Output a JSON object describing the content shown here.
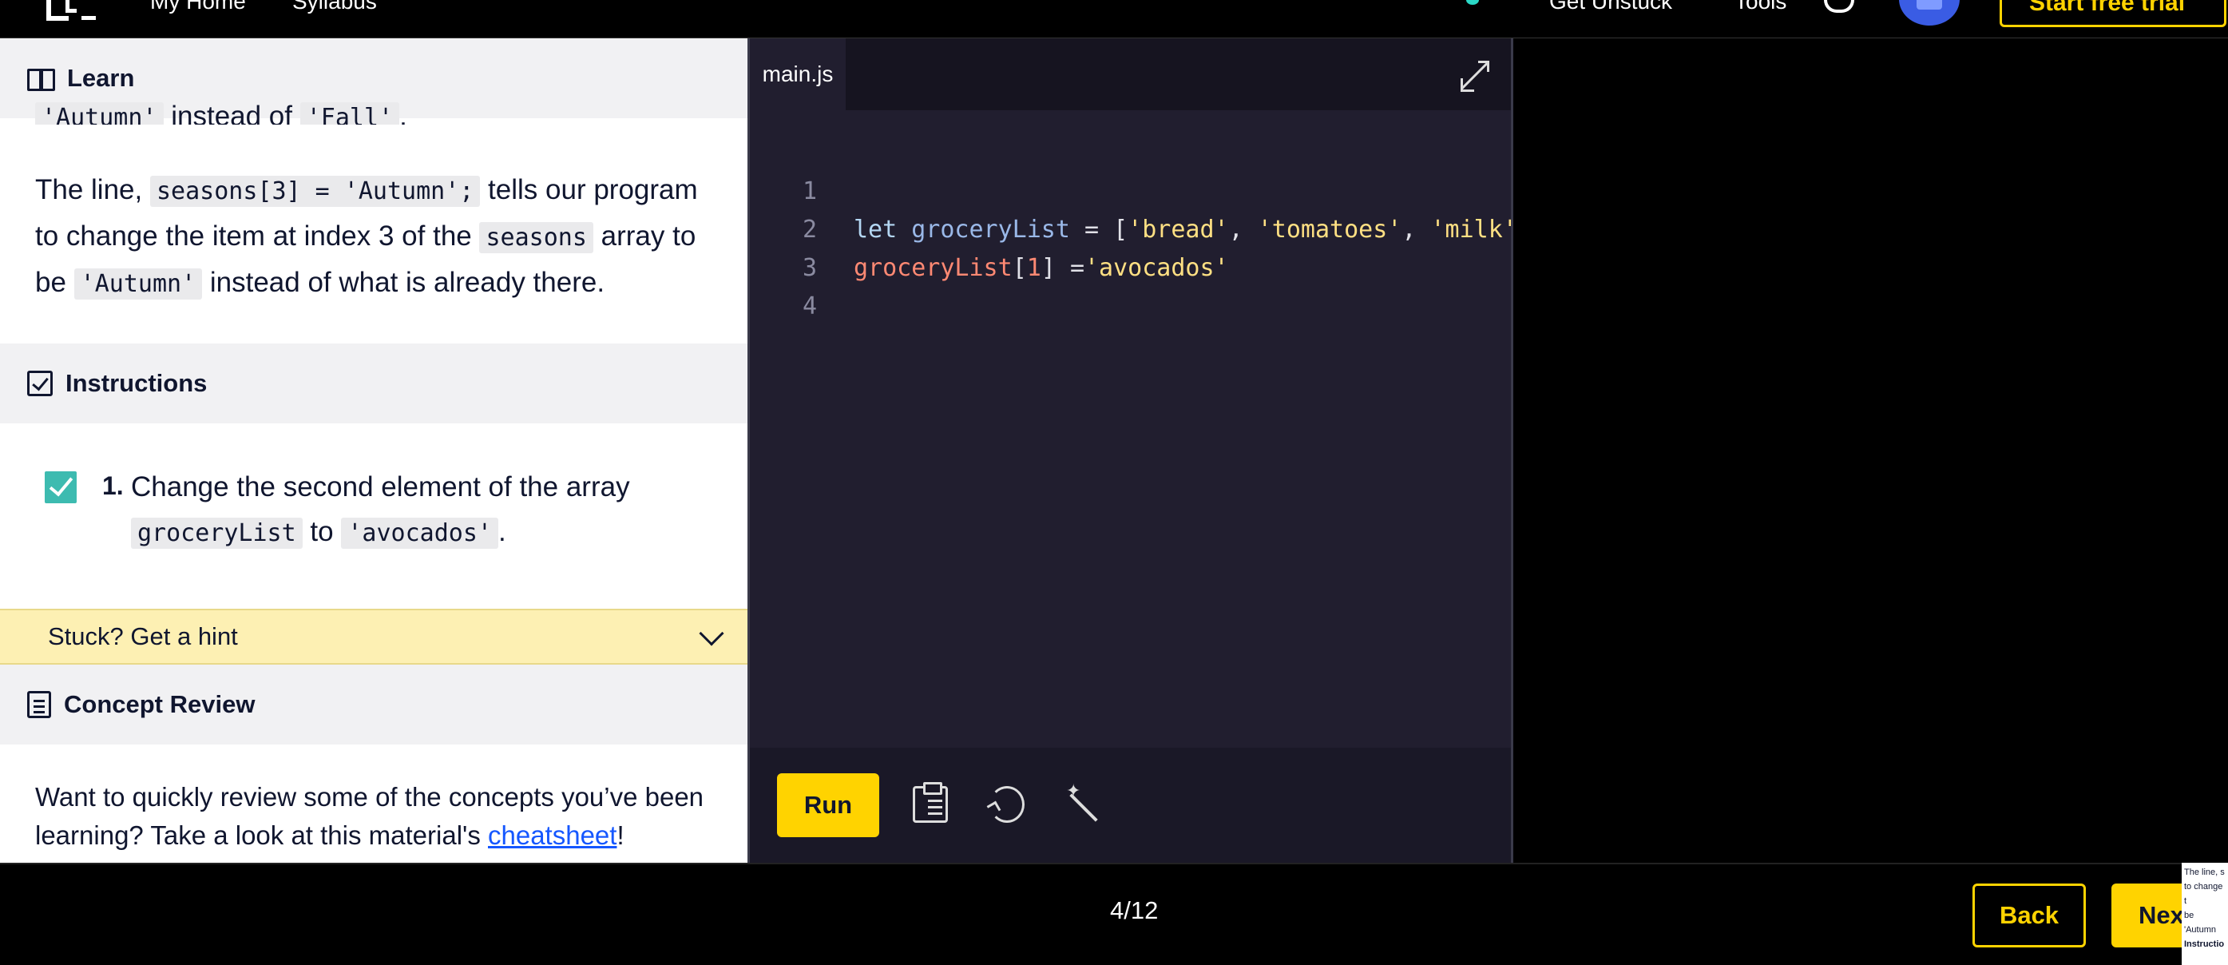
{
  "topnav": {
    "links": [
      "My Home",
      "Syllabus",
      "Get Unstuck",
      "Tools"
    ],
    "cta_label": "Start free trial"
  },
  "learn": {
    "header": "Learn",
    "partial_line_code1": "'Autumn'",
    "partial_line_mid": " instead of ",
    "partial_line_code2": "'Fall'",
    "partial_line_end": ".",
    "para_1_a": "The line, ",
    "para_1_code1": "seasons[3] = 'Autumn';",
    "para_1_b": " tells our program to change the item at index 3 of the ",
    "para_1_code2": "seasons",
    "para_1_c": " array to be ",
    "para_1_code3": "'Autumn'",
    "para_1_d": " instead of what is already there."
  },
  "instructions": {
    "header": "Instructions",
    "items": [
      {
        "number": "1.",
        "text_a": "Change the second element of the array ",
        "code1": "groceryList",
        "text_b": " to ",
        "code2": "'avocados'",
        "text_c": ".",
        "checked": true
      }
    ],
    "hint_label": "Stuck? Get a hint"
  },
  "concept_review": {
    "header": "Concept Review",
    "text_a": "Want to quickly review some of the concepts you’ve been learning? Take a look at this material's ",
    "link": "cheatsheet",
    "text_b": "!"
  },
  "editor": {
    "tab": "main.js",
    "line_numbers": [
      "1",
      "2",
      "3",
      "4"
    ],
    "lines": [
      "let groceryList = ['bread', 'tomatoes', 'milk'];",
      "groceryList[1] ='avocados'",
      "",
      ""
    ],
    "run_label": "Run"
  },
  "footer": {
    "progress": "4/12",
    "back_label": "Back",
    "next_label": "Next"
  },
  "thumbnail": {
    "lines": [
      "The line, s",
      "to change t",
      "be 'Autumn",
      "Instructio"
    ]
  },
  "colors": {
    "accent": "#ffd300",
    "editor_bg": "#211e2f",
    "check": "#3dbbb0",
    "hint_bg": "#fdf0b3",
    "link": "#1557ff"
  }
}
